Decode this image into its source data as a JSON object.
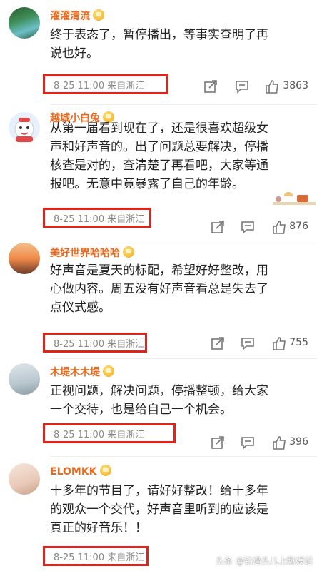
{
  "accent_color": "#e96a1f",
  "highlight_color": "#e0231b",
  "comments": [
    {
      "username": "濯濯清流",
      "text": "终于表态了，暂停播出，等事实查明了再\n说也好。",
      "meta": "8-25 11:00  来自浙江",
      "likes": "3863"
    },
    {
      "username": "越城小白兔",
      "text": "从第一届看到现在了，还是很喜欢超级女\n声和好声音的。出了问题总要解决，停播\n核查是对的，查清楚了再看吧，大家等通\n报吧。无意中竟暴露了自己的年龄。",
      "meta": "8-25 11:00  来自浙江",
      "likes": "876"
    },
    {
      "username": "美好世界哈哈哈",
      "text": "好声音是夏天的标配，希望好好整改，用\n心做内容。周五没有好声音看总是失去了\n点仪式感。",
      "meta": "8-25 11:00  来自浙江",
      "likes": "755"
    },
    {
      "username": "木堤木木堤",
      "text": "正视问题，解决问题，停播整顿，给大家\n一个交待，也是给自己一个机会。",
      "meta": "8-25 11:00  来自浙江",
      "likes": "396"
    },
    {
      "username": "ELOMKK",
      "text": "十多年的节目了，请好好整改！给十多年\n的观众一个交代，好声音里听到的应该是\n真正的好音乐！！",
      "meta": "8-25 11:00  来自浙江",
      "likes": ""
    }
  ],
  "icons": {
    "share": "share-icon",
    "comment": "comment-icon",
    "like": "thumbs-up-icon",
    "badge": "vip-crown-badge-icon"
  },
  "watermark": "头条 @钻墙头儿上瞅娱记"
}
